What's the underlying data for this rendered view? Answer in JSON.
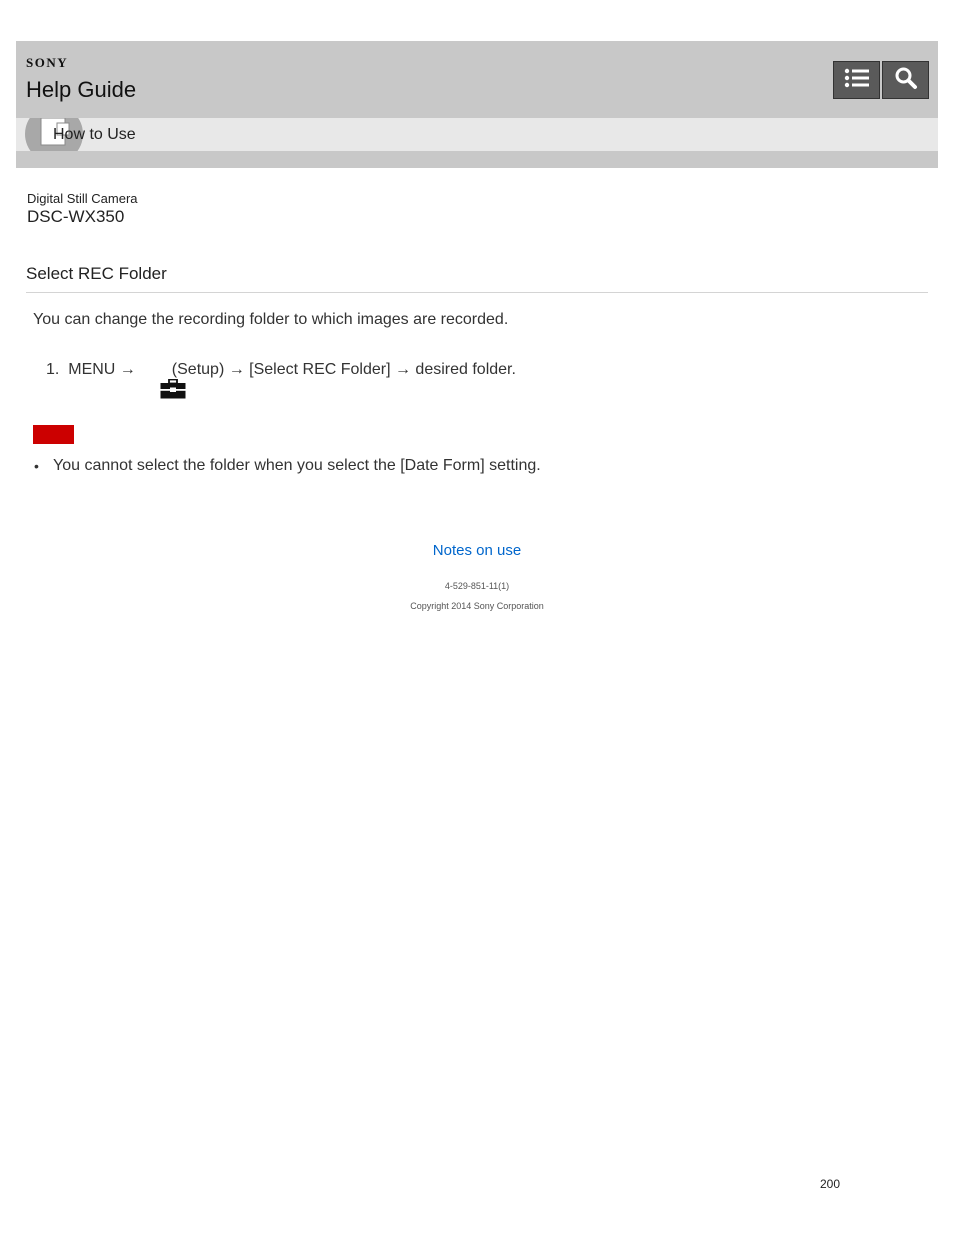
{
  "header": {
    "brand": "SONY",
    "title": "Help Guide",
    "buttons": [
      {
        "icon": "list-icon"
      },
      {
        "icon": "search-icon"
      }
    ]
  },
  "breadcrumb": {
    "icon": "how-to-use-icon",
    "label": "How to Use"
  },
  "product": {
    "category": "Digital Still Camera",
    "model": "DSC-WX350"
  },
  "article": {
    "title": "Select REC Folder",
    "intro": "You can change the recording folder to which images are recorded.",
    "step": {
      "number": "1.",
      "before_icon": "MENU →",
      "icon": "setup-toolbox-icon",
      "after_icon": "(Setup) → [Select REC Folder] → desired folder."
    },
    "note_badge_color": "#cc0000",
    "notes": [
      "You cannot select the folder when you select the [Date Form] setting."
    ]
  },
  "footer": {
    "link": "Notes on use",
    "doc_id": "4-529-851-11(1)",
    "copyright": "Copyright 2014 Sony Corporation"
  },
  "page_number": "200"
}
